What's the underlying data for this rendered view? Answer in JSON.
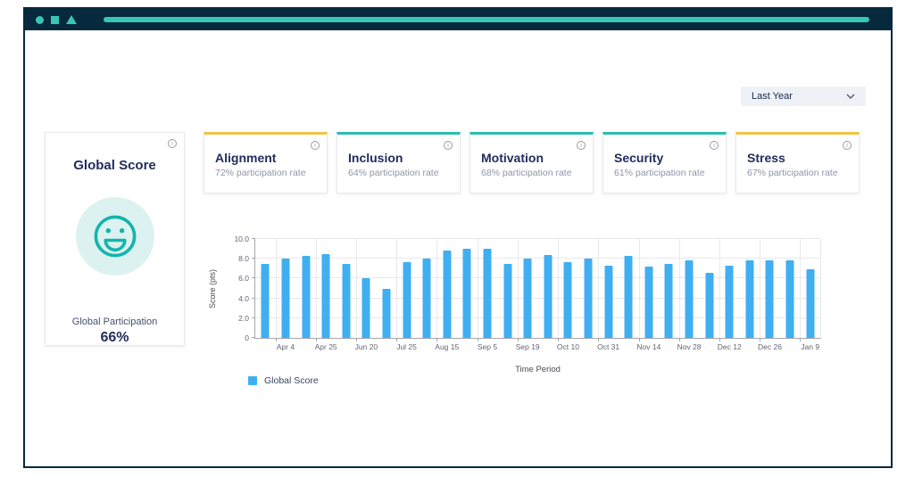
{
  "filters": {
    "period": {
      "value": "Last Year"
    }
  },
  "global_card": {
    "title": "Global Score",
    "participation_label": "Global Participation",
    "participation_value": "66%"
  },
  "metric_cards": [
    {
      "title": "Alignment",
      "subtitle": "72% participation rate",
      "accent": "#F2C344"
    },
    {
      "title": "Inclusion",
      "subtitle": "64% participation rate",
      "accent": "#2ABDB1"
    },
    {
      "title": "Motivation",
      "subtitle": "68% participation rate",
      "accent": "#2ABDB1"
    },
    {
      "title": "Security",
      "subtitle": "61% participation rate",
      "accent": "#2ABDB1"
    },
    {
      "title": "Stress",
      "subtitle": "67% participation rate",
      "accent": "#F2C344"
    }
  ],
  "chart_data": {
    "type": "bar",
    "title": "",
    "xlabel": "Time Period",
    "ylabel": "Score (pts)",
    "ylim": [
      0,
      10
    ],
    "grid": true,
    "legend_position": "bottom-left",
    "yticks": [
      {
        "value": 0,
        "label": "0"
      },
      {
        "value": 2,
        "label": "2.0"
      },
      {
        "value": 4,
        "label": "4.0"
      },
      {
        "value": 6,
        "label": "6.0"
      },
      {
        "value": 8,
        "label": "8.0"
      },
      {
        "value": 10,
        "label": "10.0"
      }
    ],
    "series": [
      {
        "name": "Global Score",
        "color": "#3FAFF2",
        "values": [
          7.5,
          8.0,
          8.3,
          8.5,
          7.5,
          6.0,
          5.0,
          7.7,
          8.0,
          8.8,
          9.0,
          9.0,
          7.5,
          8.0,
          8.4,
          7.7,
          8.0,
          7.3,
          8.3,
          7.2,
          7.5,
          7.8,
          6.6,
          7.3,
          7.8,
          7.8,
          7.8,
          6.9
        ]
      }
    ],
    "x_tick_label_every": 2,
    "x_tick_labels": [
      "Apr 4",
      "Apr 25",
      "Jun 20",
      "Jul 25",
      "Aug 15",
      "Sep 5",
      "Sep 19",
      "Oct 10",
      "Oct 31",
      "Nov 14",
      "Nov 28",
      "Dec 12",
      "Dec 26",
      "Jan 9"
    ]
  },
  "colors": {
    "titlebar_navy": "#07293D",
    "accent_teal": "#38C6B4",
    "bar_blue": "#3FAFF2",
    "heading_navy": "#222D5C",
    "muted_gray": "#8E95A5",
    "card_accent_yellow": "#F2C344",
    "card_accent_teal": "#2ABDB1",
    "smiley_bg": "#DBF2F0",
    "smiley_stroke": "#14B4AB"
  }
}
